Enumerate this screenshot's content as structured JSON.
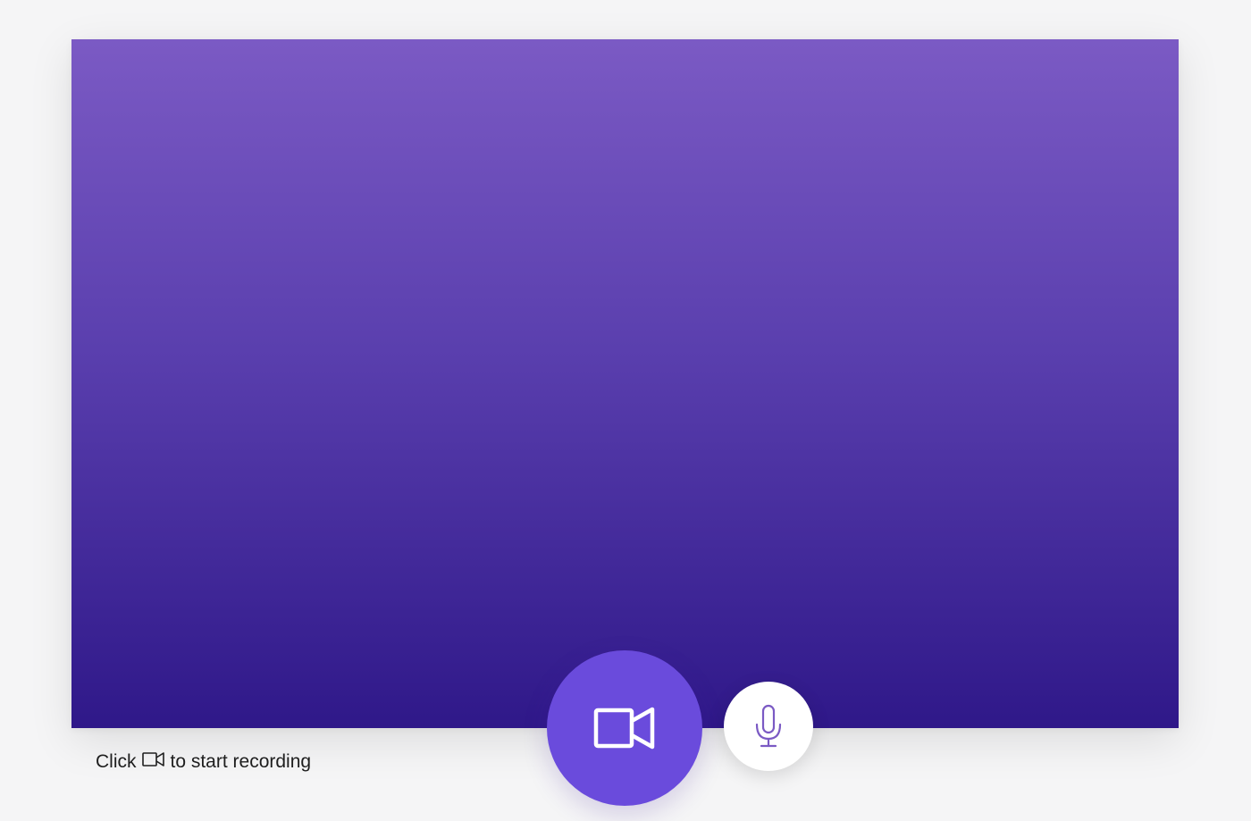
{
  "hint": {
    "prefix": "Click",
    "icon": "video-camera-icon",
    "suffix": "to start recording"
  },
  "controls": {
    "record_icon": "video-camera-icon",
    "mic_icon": "microphone-icon"
  },
  "colors": {
    "page_background": "#f5f5f6",
    "preview_gradient_top": "#7b5ac4",
    "preview_gradient_bottom": "#2f1889",
    "record_button": "#6a4bdc",
    "mic_button": "#ffffff",
    "mic_icon": "#7b5ac4"
  }
}
